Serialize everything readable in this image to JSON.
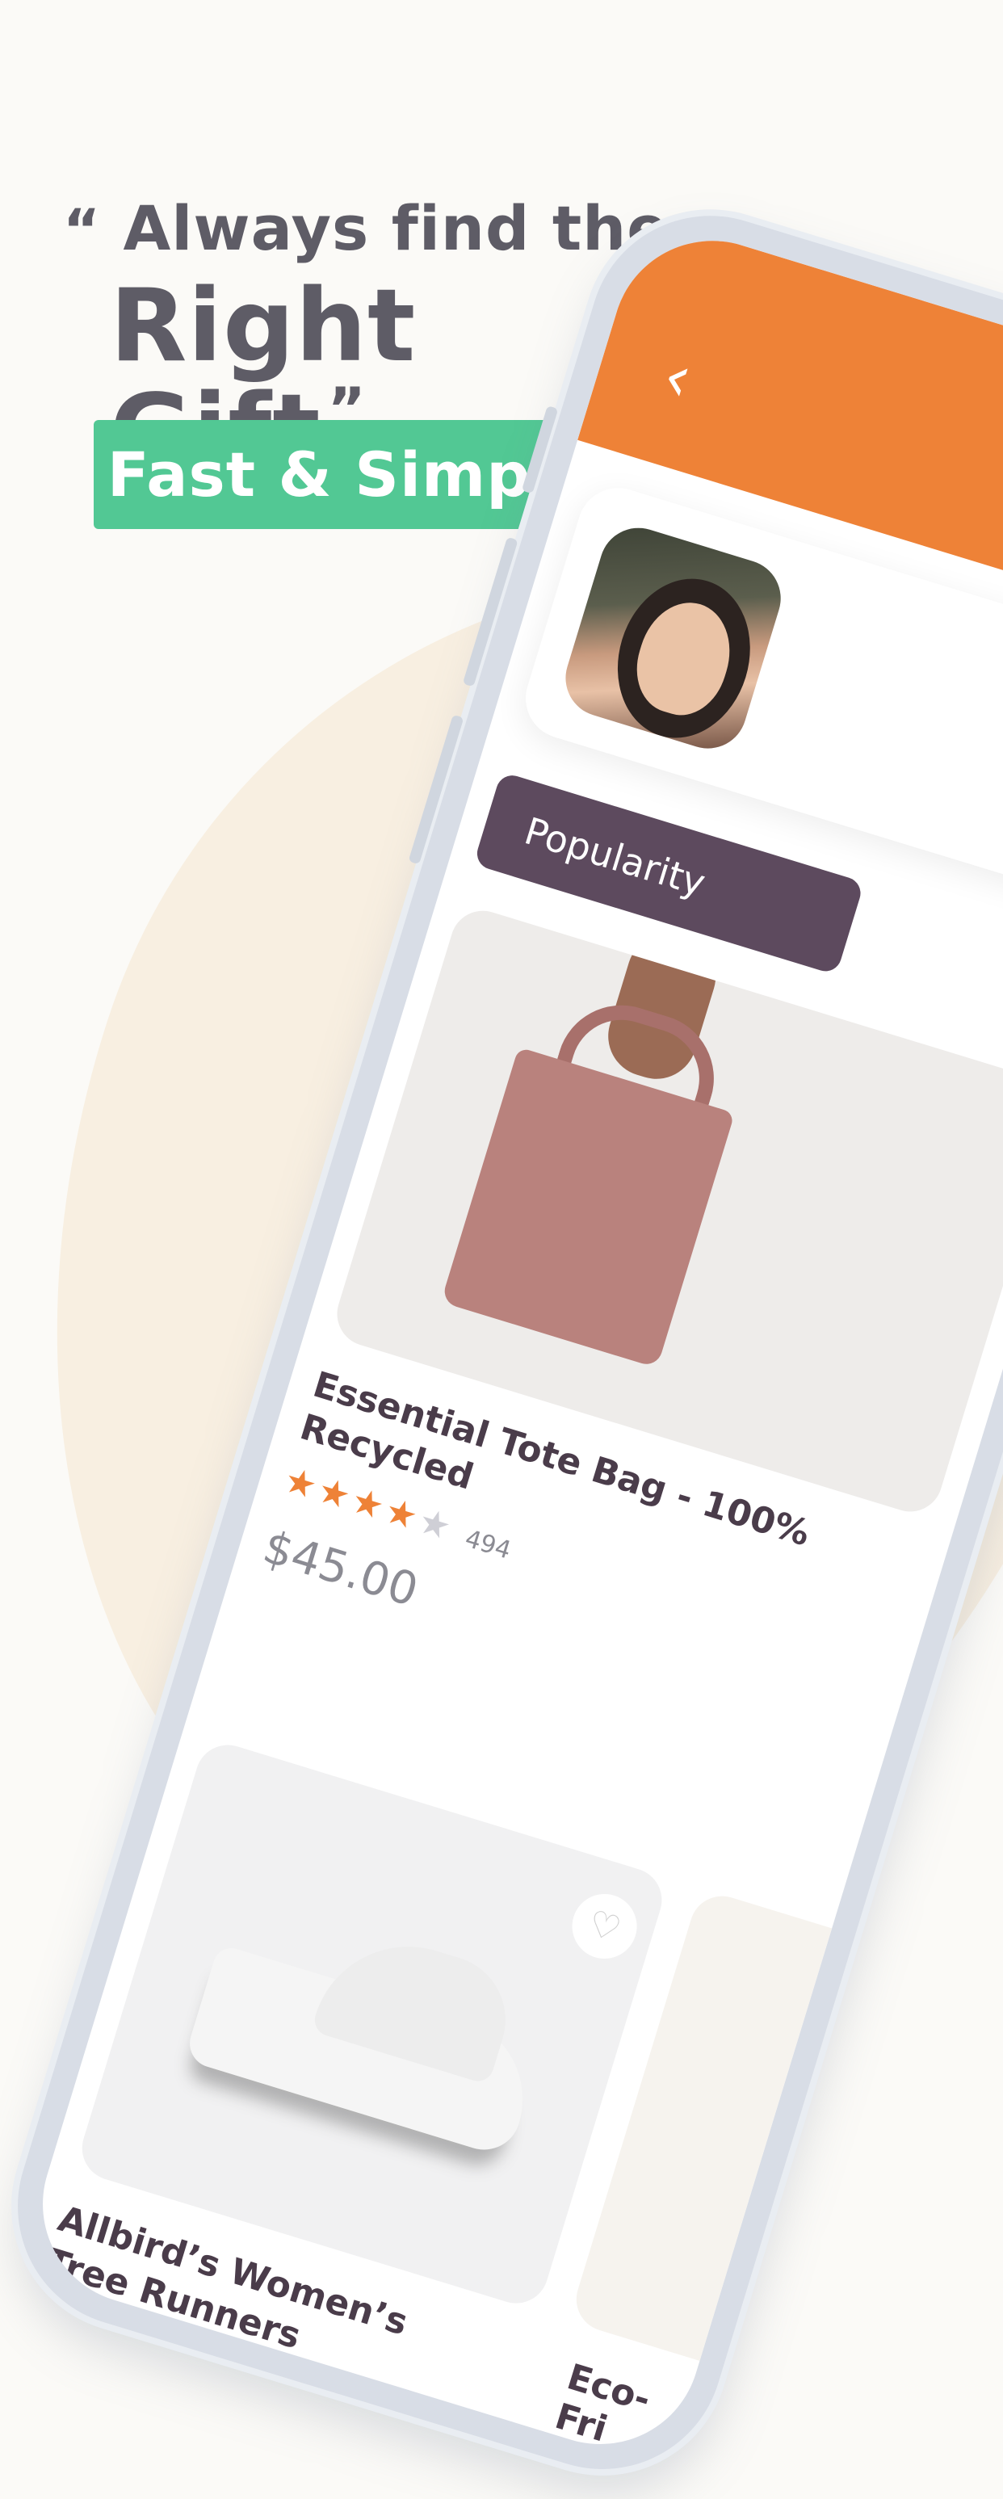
{
  "hero": {
    "open_quote": "“",
    "line1": "Always find the",
    "line2": "Right Gift",
    "close_quote": "”",
    "badge": "Fast & Simple"
  },
  "colors": {
    "accent_orange": "#ee8237",
    "badge_green": "#52c894",
    "pill_plum": "#5d4a5e",
    "blob": "#f8efe1"
  },
  "app": {
    "back_icon": "chevron-left-icon",
    "filter_label": "Popularity",
    "products": [
      {
        "title": "Essential Tote Bag - 100% Recycled",
        "rating": 4.5,
        "rating_icons": "★★★★",
        "rating_half": "★",
        "reviews": "494",
        "price": "$45.00"
      },
      {
        "title": "Allbird’s Women’s Tree Runners",
        "heart_icon": "heart-icon",
        "heart_glyph": "♡"
      },
      {
        "title": "Eco-Fri"
      }
    ]
  }
}
